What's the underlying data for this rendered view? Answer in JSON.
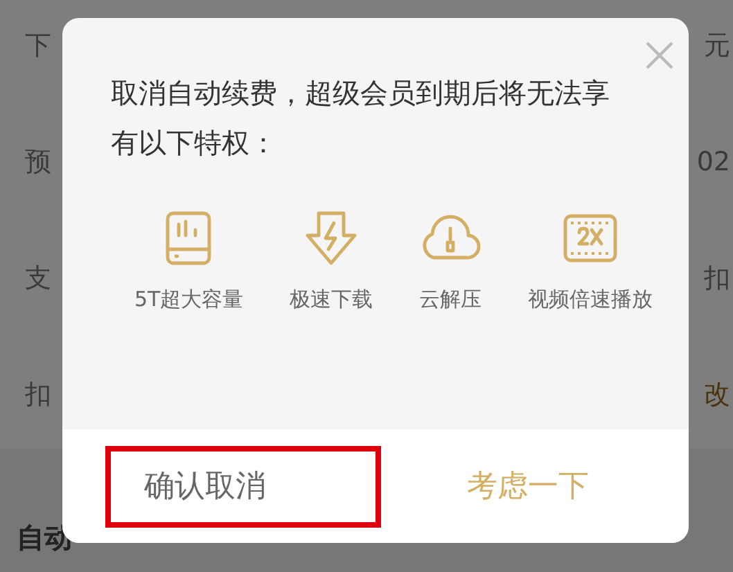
{
  "background": {
    "rows": [
      {
        "label": "下",
        "value": "元",
        "kind": "plain"
      },
      {
        "label": "预",
        "value": "02",
        "kind": "plain"
      },
      {
        "label": "支",
        "value": "扣",
        "kind": "plain"
      },
      {
        "label": "扣",
        "value": "改",
        "kind": "link"
      }
    ],
    "section_title": "自动"
  },
  "dialog": {
    "message": "取消自动续费，超级会员到期后将无法享有以下特权：",
    "features": [
      {
        "kind": "storage",
        "label": "5T超大容量"
      },
      {
        "kind": "download",
        "label": "极速下载"
      },
      {
        "kind": "cloud",
        "label": "云解压"
      },
      {
        "kind": "speed",
        "label": "视频倍速播放"
      }
    ],
    "buttons": [
      {
        "label": "确认取消",
        "kind": "secondary",
        "highlighted": true
      },
      {
        "label": "考虑一下",
        "kind": "primary",
        "highlighted": false
      }
    ]
  }
}
